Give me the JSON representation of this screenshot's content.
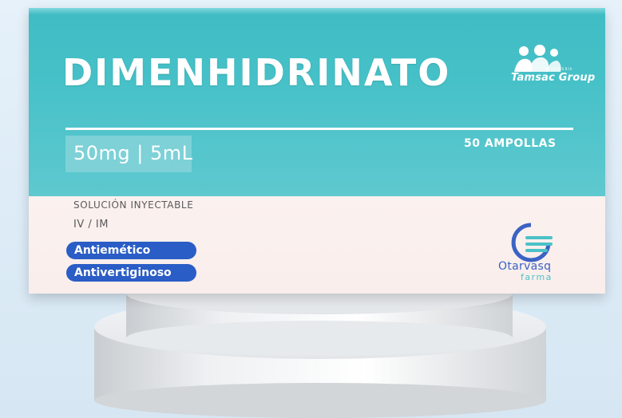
{
  "product": {
    "name": "DIMENHIDRINATO",
    "dose": "50mg | 5mL",
    "quantity": "50 AMPOLLAS",
    "form": "SOLUCIÓN INYECTABLE",
    "route": "IV / IM",
    "uses": [
      "Antiemético",
      "Antivertiginoso"
    ]
  },
  "seller": {
    "small_label": "DROGUERÍA",
    "name": "Tamsac Group"
  },
  "manufacturer": {
    "name": "Otarvasq",
    "subname": "farma"
  },
  "colors": {
    "box_top": "#45bec6",
    "box_bottom": "#faf0ee",
    "pill": "#2a5dc6",
    "maker_blue": "#3b63c4",
    "maker_teal": "#4bc2c7"
  }
}
